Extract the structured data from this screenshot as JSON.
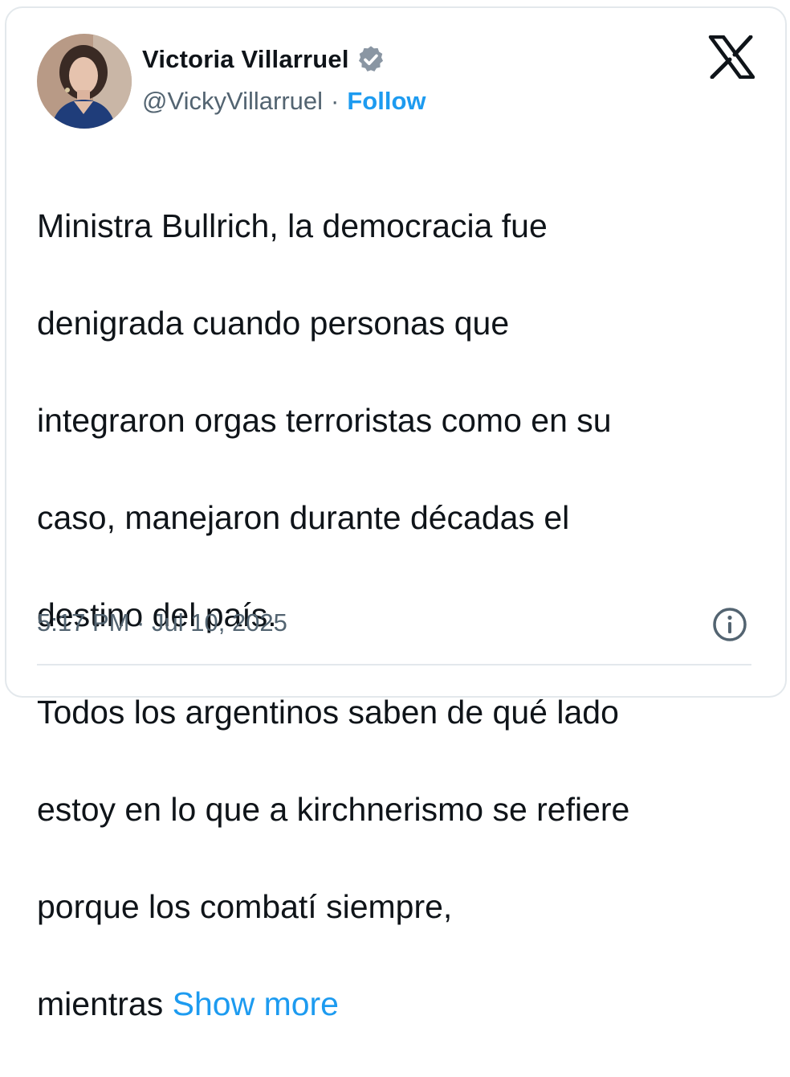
{
  "tweet": {
    "author": {
      "display_name": "Victoria Villarruel",
      "handle": "@VickyVillarruel",
      "verified": true,
      "avatar_icon": "profile-photo"
    },
    "separator": "·",
    "follow_label": "Follow",
    "text_lines": [
      "Ministra Bullrich, la democracia fue",
      "denigrada cuando personas que",
      "integraron orgas terroristas como en su",
      "caso, manejaron durante décadas el",
      "destino del país.",
      "Todos los argentinos saben de qué lado",
      "estoy en lo que a kirchnerismo se refiere",
      "porque los combatí siempre,"
    ],
    "last_line_prefix": "mientras",
    "show_more_label": "Show more",
    "timestamp": "5:17 PM · Jul 10, 2025"
  },
  "icons": {
    "brand": "x-logo-icon",
    "verified": "verified-badge-icon",
    "info": "info-icon"
  },
  "colors": {
    "text": "#0f1419",
    "secondary": "#536471",
    "accent": "#1d9bf0",
    "border": "#e3e8ec"
  }
}
